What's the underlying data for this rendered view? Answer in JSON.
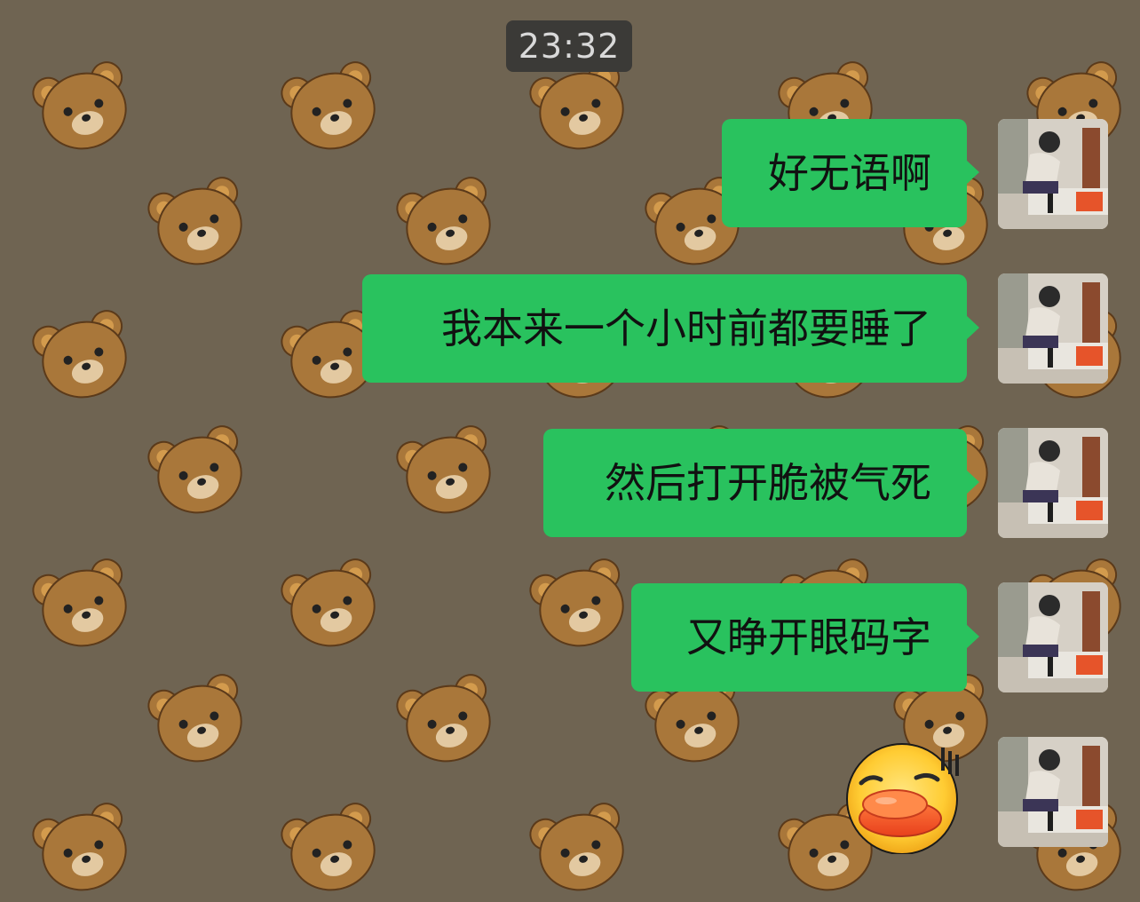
{
  "timestamp": "23:32",
  "messages": [
    {
      "sender": "me",
      "type": "text",
      "text": "好无语啊"
    },
    {
      "sender": "me",
      "type": "text",
      "text": "我本来一个小时前都要睡了"
    },
    {
      "sender": "me",
      "type": "text",
      "text": "然后打开脆被气死"
    },
    {
      "sender": "me",
      "type": "text",
      "text": "又睁开眼码字"
    },
    {
      "sender": "me",
      "type": "sticker",
      "sticker": "duck-face-sticker"
    }
  ],
  "colors": {
    "wallpaper": "#6f6452",
    "bubble_me": "#29c25e",
    "timestamp_bg": "#3b3a37"
  },
  "icons": {
    "wallpaper_pattern": "bear-face-icon",
    "avatar": "avatar-photo"
  }
}
